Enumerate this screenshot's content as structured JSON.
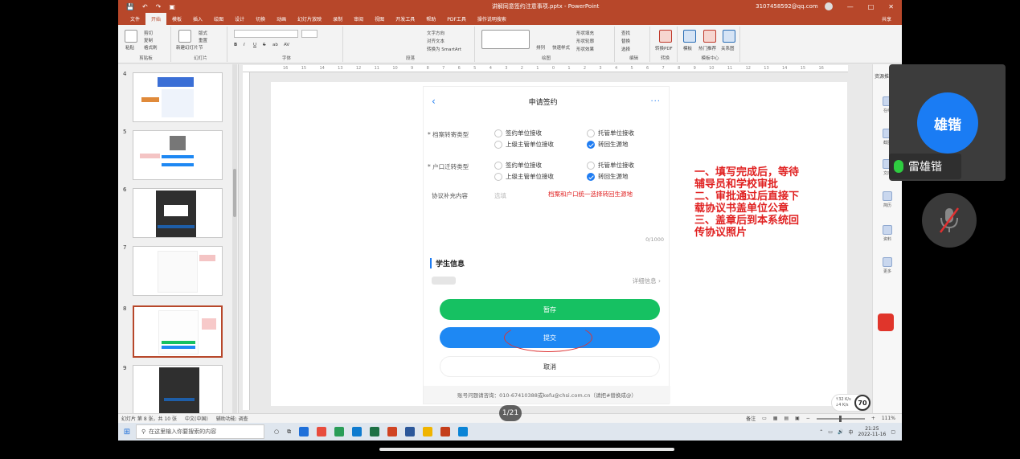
{
  "window": {
    "title": "讲解同意签约注意事项.pptx  -  PowerPoint",
    "account": "3107458592@qq.com",
    "window_controls": [
      "—",
      "□",
      "✕"
    ]
  },
  "ribbon_tabs": [
    "文件",
    "开始",
    "模板",
    "插入",
    "绘图",
    "设计",
    "切换",
    "动画",
    "幻灯片放映",
    "录制",
    "审阅",
    "视图",
    "开发工具",
    "帮助",
    "PDF工具",
    "操作说明搜索"
  ],
  "share_label": "共享",
  "ribbon": {
    "groups": [
      {
        "name": "剪贴板",
        "items": [
          "粘贴",
          "剪切",
          "复制",
          "格式刷"
        ]
      },
      {
        "name": "幻灯片",
        "items": [
          "新建幻灯片",
          "版式",
          "重置",
          "节"
        ]
      },
      {
        "name": "字体",
        "items": [
          "B",
          "I",
          "U",
          "S",
          "ab",
          "AV"
        ]
      },
      {
        "name": "段落",
        "items": [
          "文字方向",
          "对齐文本",
          "转换为 SmartArt"
        ]
      },
      {
        "name": "绘图",
        "items": [
          "排列",
          "快速样式",
          "形状填充",
          "形状轮廓",
          "形状效果"
        ]
      },
      {
        "name": "编辑",
        "items": [
          "查找",
          "替换",
          "选择"
        ]
      },
      {
        "name": "转换",
        "items": [
          "转换PDF"
        ]
      },
      {
        "name": "模板中心",
        "items": [
          "模板",
          "热门推荐",
          "关系图"
        ]
      }
    ]
  },
  "slides": [
    {
      "num": "4"
    },
    {
      "num": "5"
    },
    {
      "num": "6"
    },
    {
      "num": "7"
    },
    {
      "num": "8",
      "selected": true
    },
    {
      "num": "9"
    }
  ],
  "ruler_ticks": [
    "16",
    "15",
    "14",
    "13",
    "12",
    "11",
    "10",
    "9",
    "8",
    "7",
    "6",
    "5",
    "4",
    "3",
    "2",
    "1",
    "0",
    "1",
    "2",
    "3",
    "4",
    "5",
    "6",
    "7",
    "8",
    "9",
    "10",
    "11",
    "12",
    "13",
    "14",
    "15",
    "16"
  ],
  "phone": {
    "header_title": "申请签约",
    "back_icon": "‹",
    "more_icon": "···",
    "archive_label": "* 档案转寄类型",
    "archive_options": [
      {
        "label": "签约单位接收",
        "checked": false
      },
      {
        "label": "托管单位接收",
        "checked": false
      },
      {
        "label": "上级主管单位接收",
        "checked": false
      },
      {
        "label": "转回生源地",
        "checked": true
      }
    ],
    "hukou_label": "* 户口迁转类型",
    "hukou_options": [
      {
        "label": "签约单位接收",
        "checked": false
      },
      {
        "label": "托管单位接收",
        "checked": false
      },
      {
        "label": "上级主管单位接收",
        "checked": false
      },
      {
        "label": "转回生源地",
        "checked": true
      }
    ],
    "supplement_label": "协议补充内容",
    "supplement_placeholder": "选填",
    "supplement_note": "档案和户口统一选择转回生源地",
    "char_count": "0/1000",
    "student_section": "学生信息",
    "detail_link": "详细信息 ›",
    "btn_save": "暂存",
    "btn_submit": "提交",
    "btn_cancel": "取消",
    "footer": "账号问题请咨询：010-67410388或kefu@chsi.com.cn（请把#替换成@）"
  },
  "annotation_lines": [
    "一、填写完成后，等待",
    "辅导员和学校审批",
    "二、审批通过后直接下",
    "载协议书盖单位公章",
    "三、盖章后到本系统回",
    "传协议照片"
  ],
  "right_panel": {
    "title": "资源推荐",
    "items": [
      "在线",
      "截图",
      "文库",
      "简历",
      "资料",
      "更多"
    ]
  },
  "statusbar": {
    "slide_info": "幻灯片 第 8 张，共 10 张",
    "language": "中文(中国)",
    "accessibility": "辅助功能: 调查",
    "notes": "备注",
    "zoom": "111%"
  },
  "taskbar": {
    "search_placeholder": "在这里输入你要搜索的内容",
    "time": "21:25",
    "date": "2022-11-16",
    "ime": "中"
  },
  "video": {
    "avatar_text": "雄锴",
    "name": "雷雄锴"
  },
  "page_indicator": "1/21",
  "speed_badge": {
    "up": "↑32 K/s",
    "down": "↓4 K/s",
    "value": "70"
  },
  "colors": {
    "ppt_red": "#b7472a",
    "save_green": "#16c162",
    "submit_blue": "#1e88f3",
    "note_red": "#e02020",
    "avatar_blue": "#1a7cf4"
  }
}
